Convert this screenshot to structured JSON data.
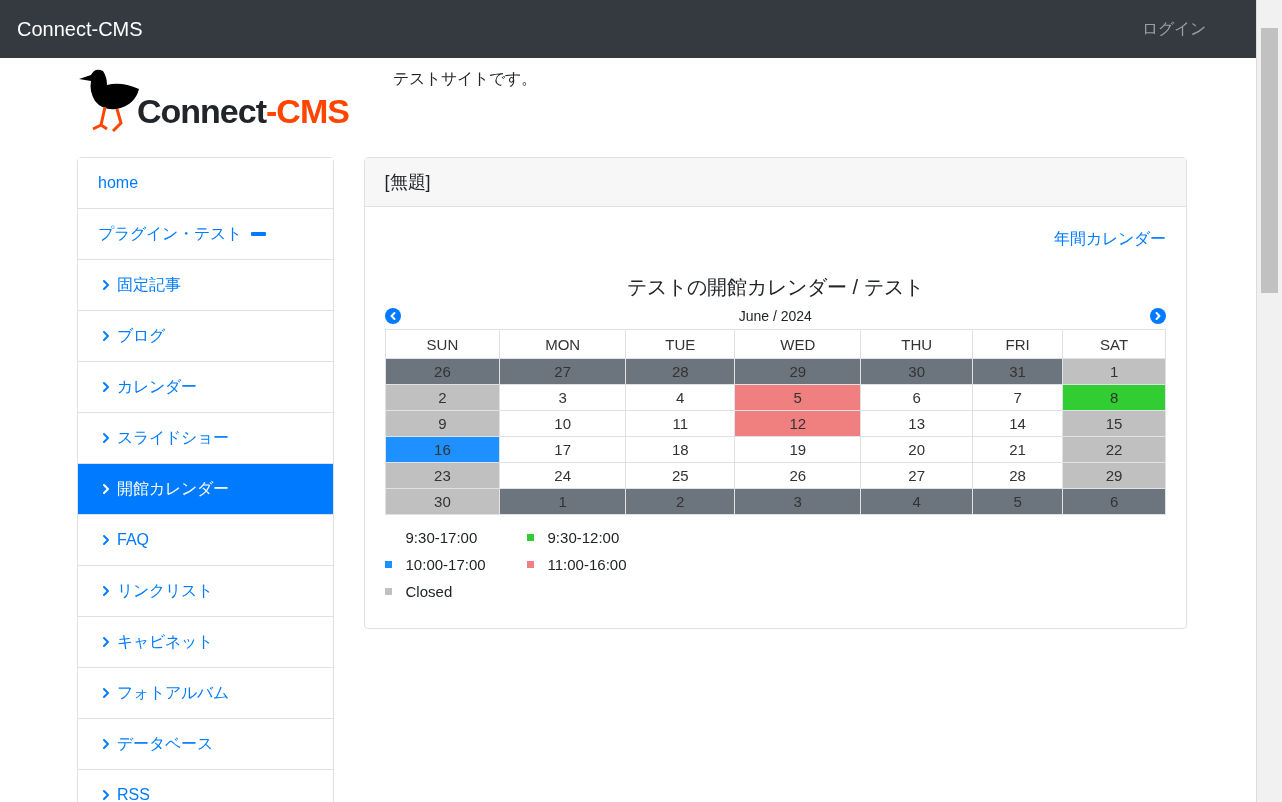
{
  "navbar": {
    "brand": "Connect-CMS",
    "login": "ログイン"
  },
  "header": {
    "logo_main": "Connect",
    "logo_accent": "-CMS",
    "tagline": "テストサイトです。"
  },
  "sidebar": {
    "items": [
      {
        "label": "home",
        "kind": "plain",
        "selected": false
      },
      {
        "label": "プラグイン・テスト",
        "kind": "dash",
        "selected": false
      },
      {
        "label": "固定記事",
        "kind": "chevron",
        "selected": false
      },
      {
        "label": "ブログ",
        "kind": "chevron",
        "selected": false
      },
      {
        "label": "カレンダー",
        "kind": "chevron",
        "selected": false
      },
      {
        "label": "スライドショー",
        "kind": "chevron",
        "selected": false
      },
      {
        "label": "開館カレンダー",
        "kind": "chevron",
        "selected": true
      },
      {
        "label": "FAQ",
        "kind": "chevron",
        "selected": false
      },
      {
        "label": "リンクリスト",
        "kind": "chevron",
        "selected": false
      },
      {
        "label": "キャビネット",
        "kind": "chevron",
        "selected": false
      },
      {
        "label": "フォトアルバム",
        "kind": "chevron",
        "selected": false
      },
      {
        "label": "データベース",
        "kind": "chevron",
        "selected": false
      },
      {
        "label": "RSS",
        "kind": "chevron",
        "selected": false
      }
    ]
  },
  "panel": {
    "title": "[無題]",
    "annual_link": "年間カレンダー",
    "calendar": {
      "title": "テストの開館カレンダー / テスト",
      "month": "June / 2024",
      "weekdays": [
        "SUN",
        "MON",
        "TUE",
        "WED",
        "THU",
        "FRI",
        "SAT"
      ],
      "weeks": [
        [
          {
            "day": "26",
            "color": "#6c757d"
          },
          {
            "day": "27",
            "color": "#6c757d"
          },
          {
            "day": "28",
            "color": "#6c757d"
          },
          {
            "day": "29",
            "color": "#6c757d"
          },
          {
            "day": "30",
            "color": "#6c757d"
          },
          {
            "day": "31",
            "color": "#6c757d"
          },
          {
            "day": "1",
            "color": "#c0c0c0"
          }
        ],
        [
          {
            "day": "2",
            "color": "#c0c0c0"
          },
          {
            "day": "3",
            "color": "#ffffff"
          },
          {
            "day": "4",
            "color": "#ffffff"
          },
          {
            "day": "5",
            "color": "#f08080"
          },
          {
            "day": "6",
            "color": "#ffffff"
          },
          {
            "day": "7",
            "color": "#ffffff"
          },
          {
            "day": "8",
            "color": "#32cd32"
          }
        ],
        [
          {
            "day": "9",
            "color": "#c0c0c0"
          },
          {
            "day": "10",
            "color": "#ffffff"
          },
          {
            "day": "11",
            "color": "#ffffff"
          },
          {
            "day": "12",
            "color": "#f08080"
          },
          {
            "day": "13",
            "color": "#ffffff"
          },
          {
            "day": "14",
            "color": "#ffffff"
          },
          {
            "day": "15",
            "color": "#c0c0c0"
          }
        ],
        [
          {
            "day": "16",
            "color": "#1e90ff"
          },
          {
            "day": "17",
            "color": "#ffffff"
          },
          {
            "day": "18",
            "color": "#ffffff"
          },
          {
            "day": "19",
            "color": "#ffffff"
          },
          {
            "day": "20",
            "color": "#ffffff"
          },
          {
            "day": "21",
            "color": "#ffffff"
          },
          {
            "day": "22",
            "color": "#c0c0c0"
          }
        ],
        [
          {
            "day": "23",
            "color": "#c0c0c0"
          },
          {
            "day": "24",
            "color": "#ffffff"
          },
          {
            "day": "25",
            "color": "#ffffff"
          },
          {
            "day": "26",
            "color": "#ffffff"
          },
          {
            "day": "27",
            "color": "#ffffff"
          },
          {
            "day": "28",
            "color": "#ffffff"
          },
          {
            "day": "29",
            "color": "#c0c0c0"
          }
        ],
        [
          {
            "day": "30",
            "color": "#c0c0c0"
          },
          {
            "day": "1",
            "color": "#6c757d"
          },
          {
            "day": "2",
            "color": "#6c757d"
          },
          {
            "day": "3",
            "color": "#6c757d"
          },
          {
            "day": "4",
            "color": "#6c757d"
          },
          {
            "day": "5",
            "color": "#6c757d"
          },
          {
            "day": "6",
            "color": "#6c757d"
          }
        ]
      ],
      "legend": [
        {
          "label": "9:30-17:00"
        },
        {
          "label": "9:30-12:00",
          "color": "#32cd32"
        },
        {
          "label": "10:00-17:00",
          "color": "#1e90ff"
        },
        {
          "label": "11:00-16:00",
          "color": "#f08080"
        },
        {
          "label": "Closed",
          "color": "#c0c0c0"
        }
      ]
    }
  }
}
